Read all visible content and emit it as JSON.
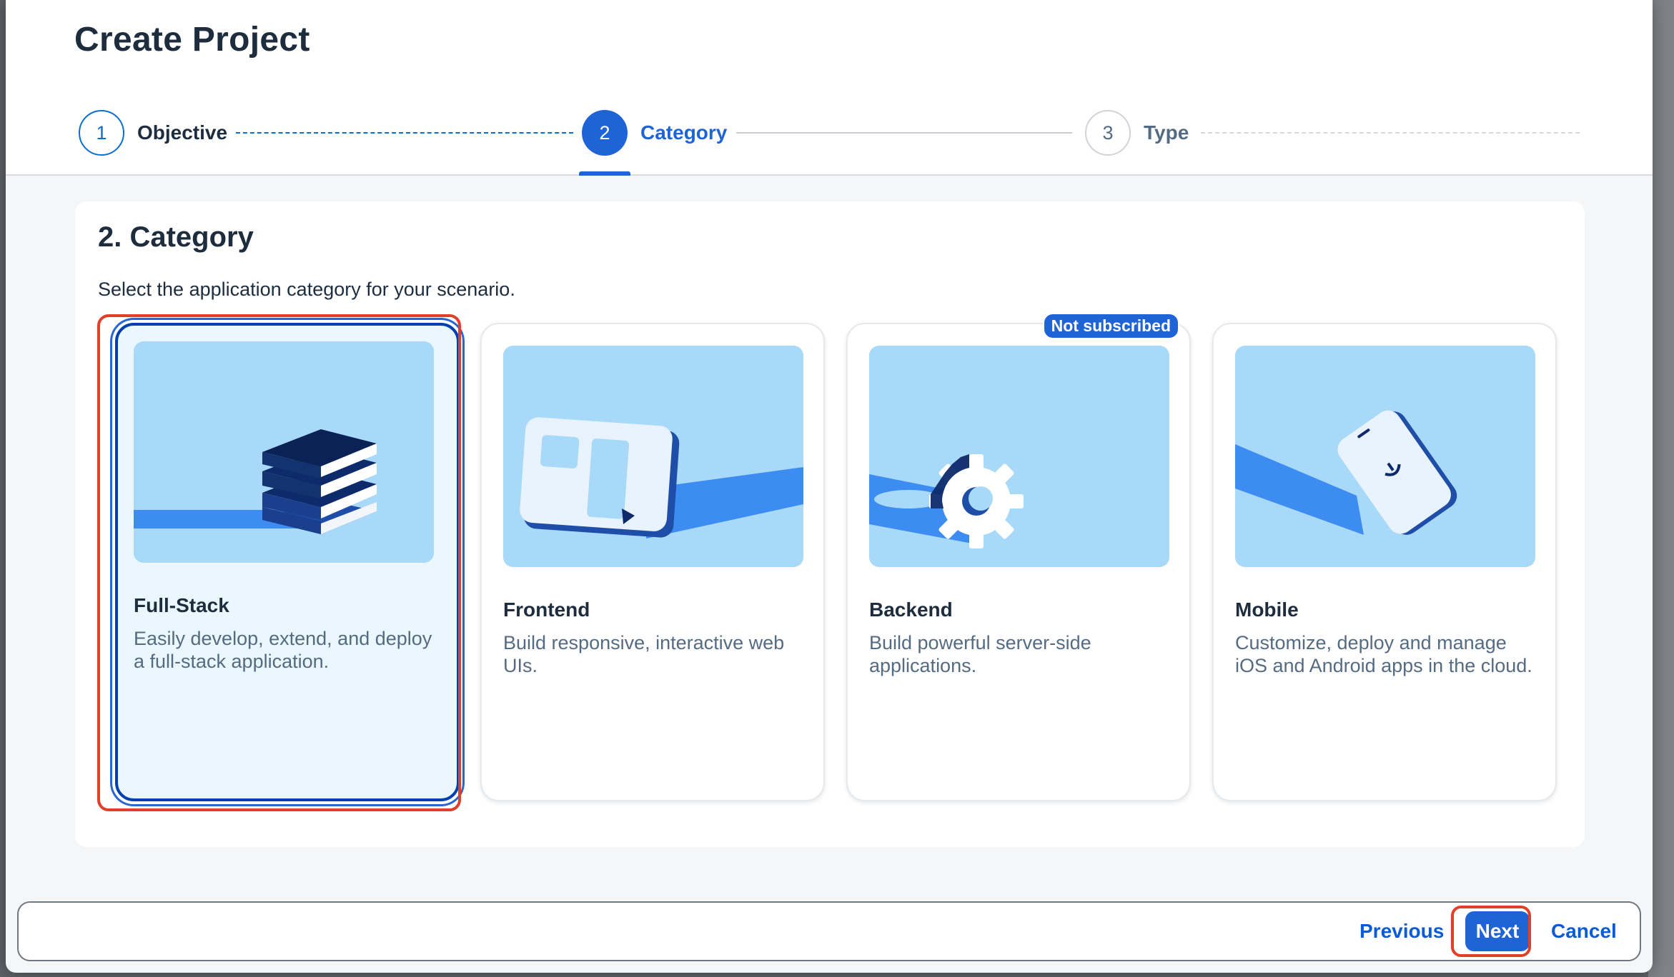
{
  "dialog": {
    "title": "Create Project"
  },
  "wizard": {
    "steps": [
      {
        "number": "1",
        "label": "Objective",
        "state": "completed"
      },
      {
        "number": "2",
        "label": "Category",
        "state": "current"
      },
      {
        "number": "3",
        "label": "Type",
        "state": "upcoming"
      }
    ]
  },
  "section": {
    "title": "2. Category",
    "subtitle": "Select the application category for your scenario."
  },
  "cards": [
    {
      "title": "Full-Stack",
      "description": "Easily develop, extend, and deploy a full-stack application.",
      "selected": true,
      "icon": "stack-layers-illustration"
    },
    {
      "title": "Frontend",
      "description": "Build responsive, interactive web UIs.",
      "selected": false,
      "icon": "tablet-ui-illustration"
    },
    {
      "title": "Backend",
      "description": "Build powerful server-side applications.",
      "selected": false,
      "badge": "Not subscribed",
      "icon": "gear-illustration"
    },
    {
      "title": "Mobile",
      "description": "Customize, deploy and manage iOS and Android apps in the cloud.",
      "selected": false,
      "icon": "mobile-phone-illustration"
    }
  ],
  "footer": {
    "previous_label": "Previous",
    "next_label": "Next",
    "cancel_label": "Cancel"
  },
  "colors": {
    "accent": "#1f64d6",
    "illustration_bg": "#a9d9f8",
    "highlight": "#e0402a"
  }
}
